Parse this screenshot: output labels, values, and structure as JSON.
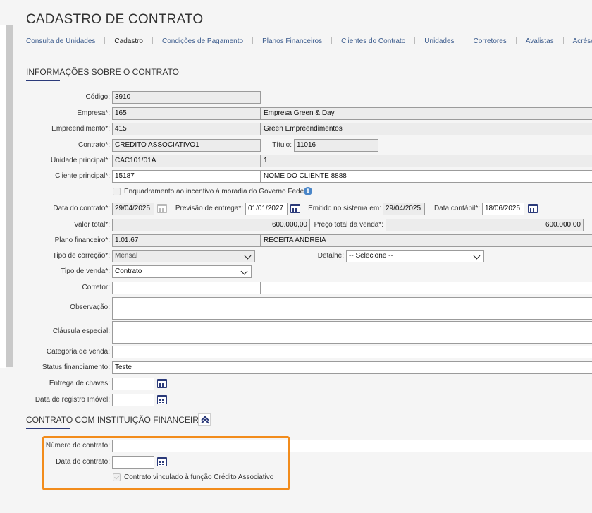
{
  "page": {
    "title": "CADASTRO DE CONTRATO"
  },
  "tabs": [
    {
      "label": "Consulta de Unidades"
    },
    {
      "label": "Cadastro"
    },
    {
      "label": "Condições de Pagamento"
    },
    {
      "label": "Planos Financeiros"
    },
    {
      "label": "Clientes do Contrato"
    },
    {
      "label": "Unidades"
    },
    {
      "label": "Corretores"
    },
    {
      "label": "Avalistas"
    },
    {
      "label": "Acréscimo"
    }
  ],
  "section1": {
    "title": "INFORMAÇÕES SOBRE O CONTRATO"
  },
  "form": {
    "codigo": {
      "label": "Código:",
      "value": "3910"
    },
    "empresa": {
      "label": "Empresa*:",
      "code": "165",
      "name": "Empresa Green & Day"
    },
    "empreendimento": {
      "label": "Empreendimento*:",
      "code": "415",
      "name": "Green Empreendimentos"
    },
    "contrato": {
      "label": "Contrato*:",
      "value": "CREDITO ASSOCIATIVO1"
    },
    "titulo": {
      "label": "Título:",
      "value": "11016"
    },
    "unidade_principal": {
      "label": "Unidade principal*:",
      "value": "CAC101/01A",
      "extra": "1"
    },
    "cliente_principal": {
      "label": "Cliente principal*:",
      "code": "15187",
      "name": "NOME DO CLIENTE 8888"
    },
    "enquadramento": {
      "label": "Enquadramento ao incentivo à moradia do Governo Federal"
    },
    "data_contrato": {
      "label": "Data do contrato*:",
      "value": "29/04/2025"
    },
    "previsao_entrega": {
      "label": "Previsão de entrega*:",
      "value": "01/01/2027"
    },
    "emitido_sistema": {
      "label": "Emitido no sistema em:",
      "value": "29/04/2025"
    },
    "data_contabil": {
      "label": "Data contábil*:",
      "value": "18/06/2025"
    },
    "valor_total": {
      "label": "Valor total*:",
      "value": "600.000,00"
    },
    "preco_total_venda": {
      "label": "Preço total da venda*:",
      "value": "600.000,00"
    },
    "plano_financeiro": {
      "label": "Plano financeiro*:",
      "code": "1.01.67",
      "name": "RECEITA ANDREIA"
    },
    "tipo_correcao": {
      "label": "Tipo de correção*:",
      "value": "Mensal"
    },
    "detalhe": {
      "label": "Detalhe:",
      "value": "-- Selecione --"
    },
    "tipo_venda": {
      "label": "Tipo de venda*:",
      "value": "Contrato"
    },
    "corretor": {
      "label": "Corretor:",
      "value": ""
    },
    "observacao": {
      "label": "Observação:",
      "value": ""
    },
    "clausula_especial": {
      "label": "Cláusula especial:",
      "value": ""
    },
    "categoria_venda": {
      "label": "Categoria de venda:",
      "value": ""
    },
    "status_financiamento": {
      "label": "Status financiamento:",
      "value": "Teste"
    },
    "entrega_chaves": {
      "label": "Entrega de chaves:",
      "value": ""
    },
    "data_registro_imovel": {
      "label": "Data de registro Imóvel:",
      "value": ""
    }
  },
  "section2": {
    "title": "CONTRATO COM INSTITUIÇÃO FINANCEIRA",
    "numero_contrato": {
      "label": "Número do contrato:",
      "value": ""
    },
    "data_contrato": {
      "label": "Data do contrato:",
      "value": ""
    },
    "vinculado": {
      "label": "Contrato vinculado à função Crédito Associativo"
    }
  },
  "colors": {
    "accent": "#2b3a7a",
    "highlight": "#f28c1c",
    "link": "#3a5a8c"
  }
}
